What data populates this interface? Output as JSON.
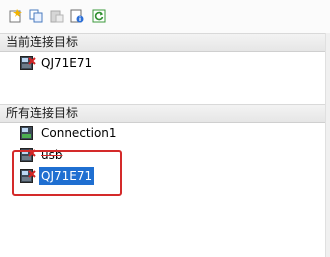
{
  "toolbar": {
    "buttons": [
      {
        "icon": "new-connection-icon"
      },
      {
        "icon": "copy-icon"
      },
      {
        "icon": "paste-icon"
      },
      {
        "icon": "properties-icon"
      },
      {
        "icon": "refresh-icon"
      }
    ]
  },
  "current_target": {
    "header": "当前连接目标",
    "items": [
      {
        "label": "QJ71E71",
        "icon": "plc-device-icon"
      }
    ]
  },
  "all_targets": {
    "header": "所有连接目标",
    "items": [
      {
        "label": "Connection1",
        "icon": "plc-device-icon"
      },
      {
        "label": "usb",
        "icon": "plc-device-icon"
      },
      {
        "label": "QJ71E71",
        "icon": "plc-device-icon",
        "selected": true
      }
    ]
  },
  "colors": {
    "selection": "#1f6fd1",
    "annotation_red": "#d42a2a"
  }
}
